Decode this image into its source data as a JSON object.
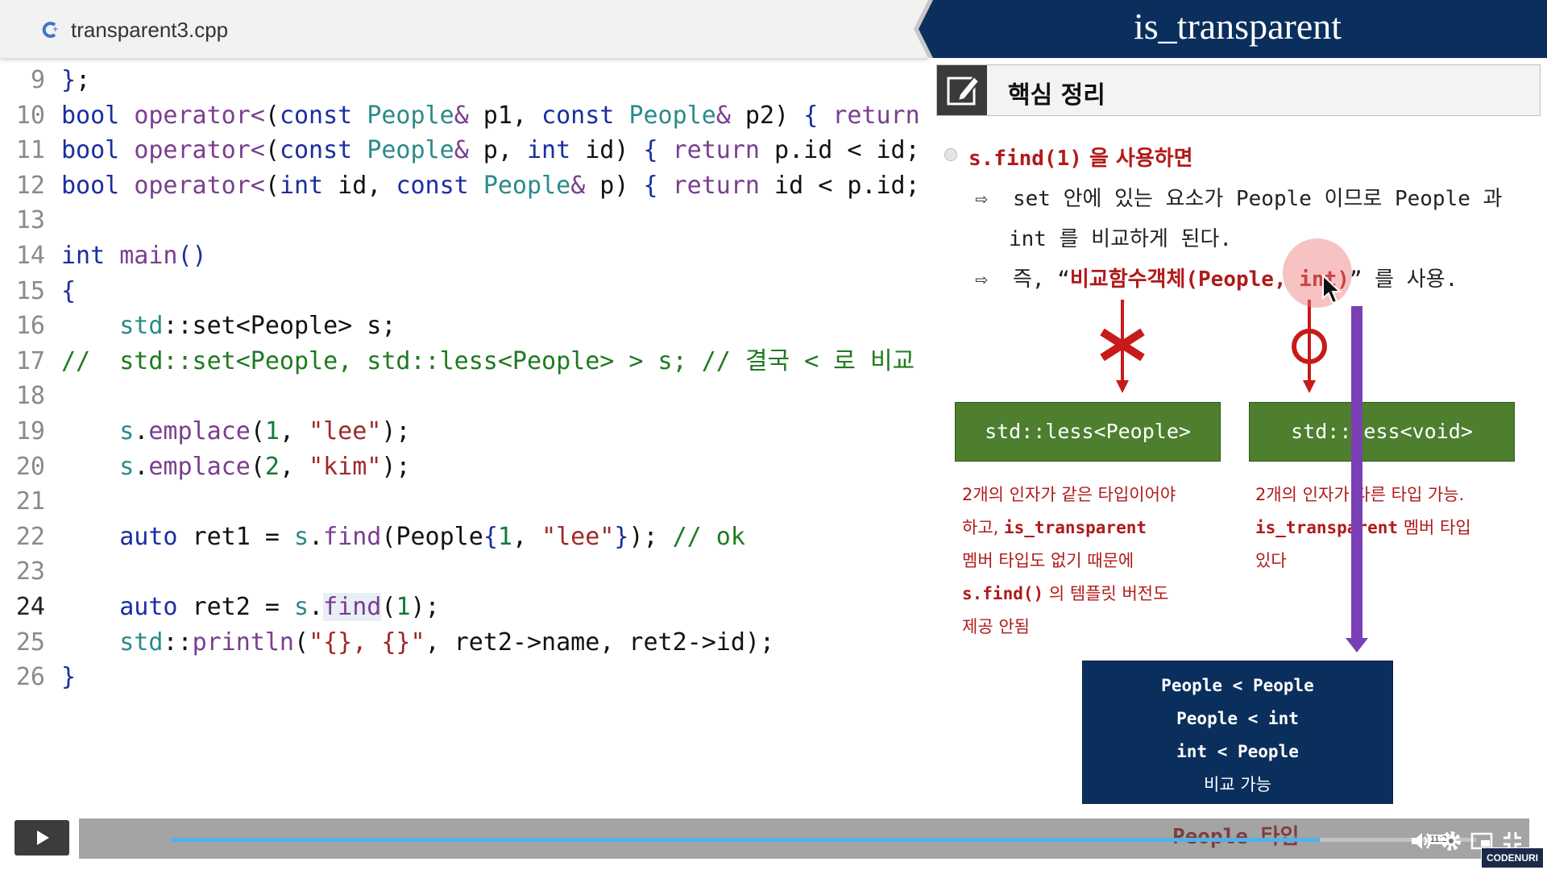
{
  "editor": {
    "tab_name": "transparent3.cpp",
    "current_line": 24
  },
  "slide": {
    "title": "is_transparent",
    "summary_label": "핵심 정리",
    "bullet_code": "s.find(1)",
    "bullet_text": " 을 사용하면",
    "arrow1_text1": "set 안에 있는 요소가 People 이므로 People 과",
    "arrow1_text2": "int 를 비교하게 된다.",
    "arrow2_prefix": "즉, “",
    "arrow2_red": "비교함수객체(People, int)",
    "arrow2_suffix": "” 를 사용.",
    "arrow_glyph": "⇨",
    "left_box": "std::less<People>",
    "right_box": "std::less<void>",
    "left_note": {
      "l1": "2개의 인자가 같은 타입이어야",
      "l2a": "하고, ",
      "l2b": "is_transparent",
      "l3": "멤버 타입도 없기 때문에",
      "l4a": "s.find()",
      "l4b": " 의 템플릿 버전도",
      "l5": "제공 안됨"
    },
    "right_note": {
      "l1": "2개의 인자가 다른 타입 가능.",
      "l2a": "is_transparent",
      "l2b": " 멤버 타입",
      "l3": "있다"
    },
    "navy": {
      "l1": "People < People",
      "l2": "People < int",
      "l3": "int < People",
      "l4": "비교 가능"
    },
    "people_type": "People 타입"
  },
  "player": {
    "time_tooltip": "11:23",
    "progress": 0.88
  },
  "brand": "CODENURI",
  "colors": {
    "header_navy": "#0b2f5c",
    "green_box": "#4d7f2e",
    "note_red": "#b01a1a",
    "arrow_purple": "#7b3fb5",
    "seek_blue": "#4fb3e8"
  }
}
